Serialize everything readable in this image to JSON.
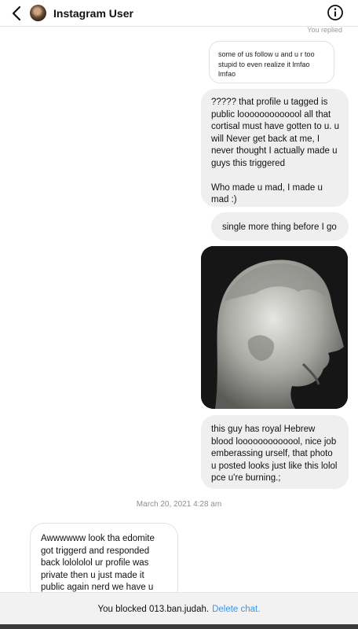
{
  "header": {
    "title": "Instagram User"
  },
  "messages": {
    "you_replied_label": "You replied",
    "quoted_text": "some of us follow u and u r too stupid to even realize it lmfao lmfao",
    "outgoing_1": "????? that profile u tagged is public looooooooooool all that cortisal must have gotten to u. u will Never get back at me, I never thought I actually made u guys this triggered\n\nWho made u mad, I made u mad :)",
    "outgoing_2": "single more thing before I go",
    "outgoing_3": "this guy has royal Hebrew blood looooooooooool, nice job emberassing urself, that photo u posted looks just like this lolol pce u're burning.;",
    "date_stamp": "March 20, 2021 4:28 am",
    "incoming_1": "Awwwwww look tha edomite got triggerd and responded back lolololol ur profile was private then u just made it public again nerd we have u wrapped around our fingers"
  },
  "footer": {
    "blocked_text": "You blocked 013.ban.judah.",
    "delete_label": "Delete chat."
  },
  "colors": {
    "link": "#3897f0",
    "bubble_out": "#efefef"
  }
}
